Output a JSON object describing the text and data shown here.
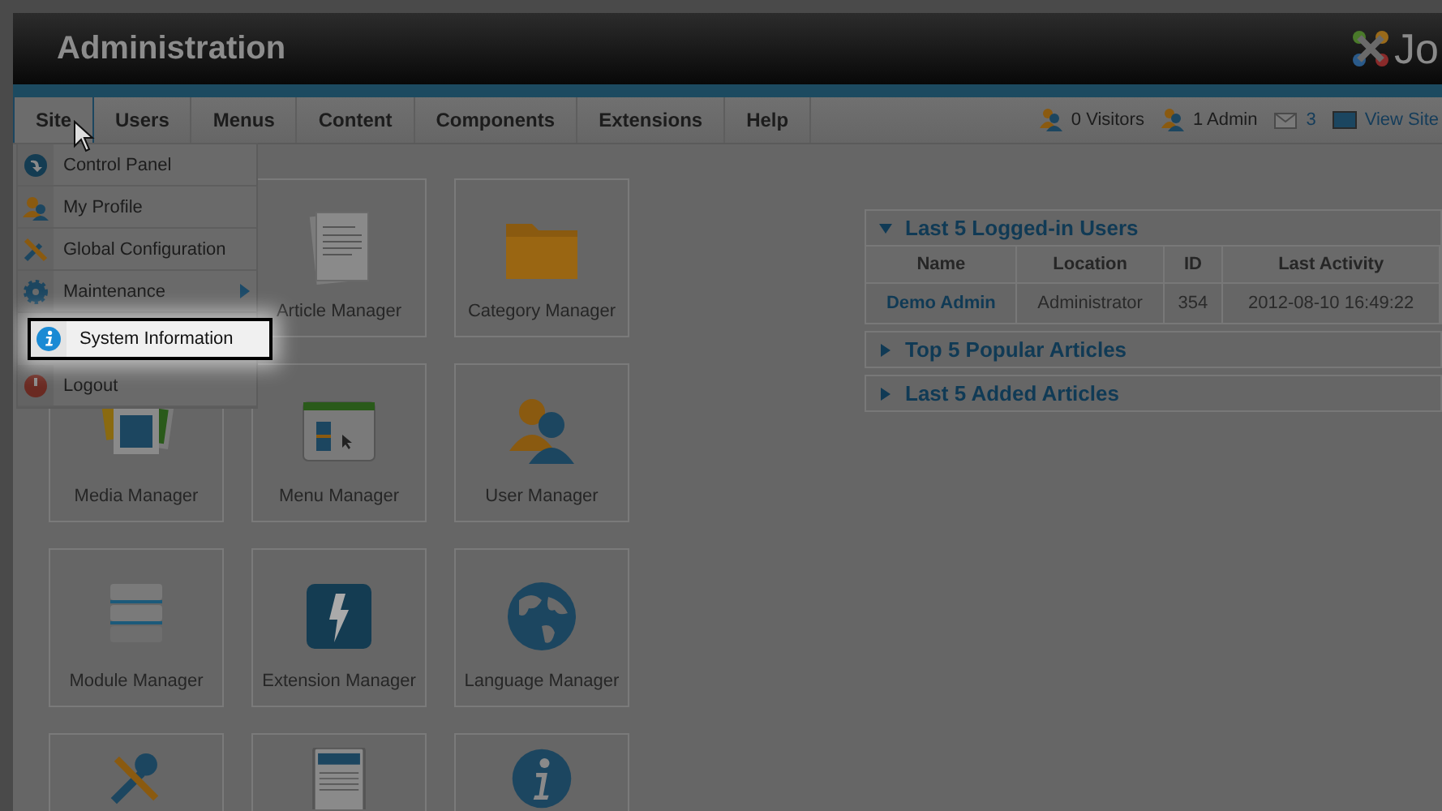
{
  "header": {
    "title": "Administration",
    "logo_text": "Jo"
  },
  "nav": {
    "tabs": [
      {
        "label": "Site",
        "selected": true
      },
      {
        "label": "Users",
        "selected": false
      },
      {
        "label": "Menus",
        "selected": false
      },
      {
        "label": "Content",
        "selected": false
      },
      {
        "label": "Components",
        "selected": false
      },
      {
        "label": "Extensions",
        "selected": false
      },
      {
        "label": "Help",
        "selected": false
      }
    ],
    "status": [
      {
        "kind": "visitors",
        "text": "0 Visitors"
      },
      {
        "kind": "admins",
        "text": "1 Admin"
      },
      {
        "kind": "messages",
        "text": "3"
      },
      {
        "kind": "site",
        "text": "View Site"
      }
    ]
  },
  "site_menu": [
    {
      "label": "Control Panel",
      "selected": false,
      "submenu": false
    },
    {
      "label": "My Profile",
      "selected": false,
      "submenu": false
    },
    {
      "label": "Global Configuration",
      "selected": false,
      "submenu": false
    },
    {
      "label": "Maintenance",
      "selected": false,
      "submenu": true
    },
    {
      "label": "System Information",
      "selected": true,
      "submenu": false
    },
    {
      "label": "Logout",
      "selected": false,
      "submenu": false
    }
  ],
  "quick_icons": [
    {
      "kind": "labeled",
      "label": "Article Manager"
    },
    {
      "kind": "labeled",
      "label": "Category Manager"
    },
    {
      "kind": "labeled",
      "label": "Media Manager"
    },
    {
      "kind": "labeled",
      "label": "Menu Manager"
    },
    {
      "kind": "labeled",
      "label": "User Manager"
    },
    {
      "kind": "labeled",
      "label": "Module Manager"
    },
    {
      "kind": "labeled",
      "label": "Extension Manager"
    },
    {
      "kind": "labeled",
      "label": "Language Manager"
    },
    {
      "kind": "cut"
    },
    {
      "kind": "cut"
    },
    {
      "kind": "cut"
    }
  ],
  "panels": [
    {
      "title": "Last 5 Logged-in Users",
      "expanded": true,
      "table": {
        "columns": [
          "Name",
          "Location",
          "ID",
          "Last Activity"
        ],
        "rows": [
          [
            "Demo Admin",
            "Administrator",
            "354",
            "2012-08-10 16:49:22"
          ]
        ]
      }
    },
    {
      "title": "Top 5 Popular Articles",
      "expanded": false
    },
    {
      "title": "Last 5 Added Articles",
      "expanded": false
    }
  ]
}
